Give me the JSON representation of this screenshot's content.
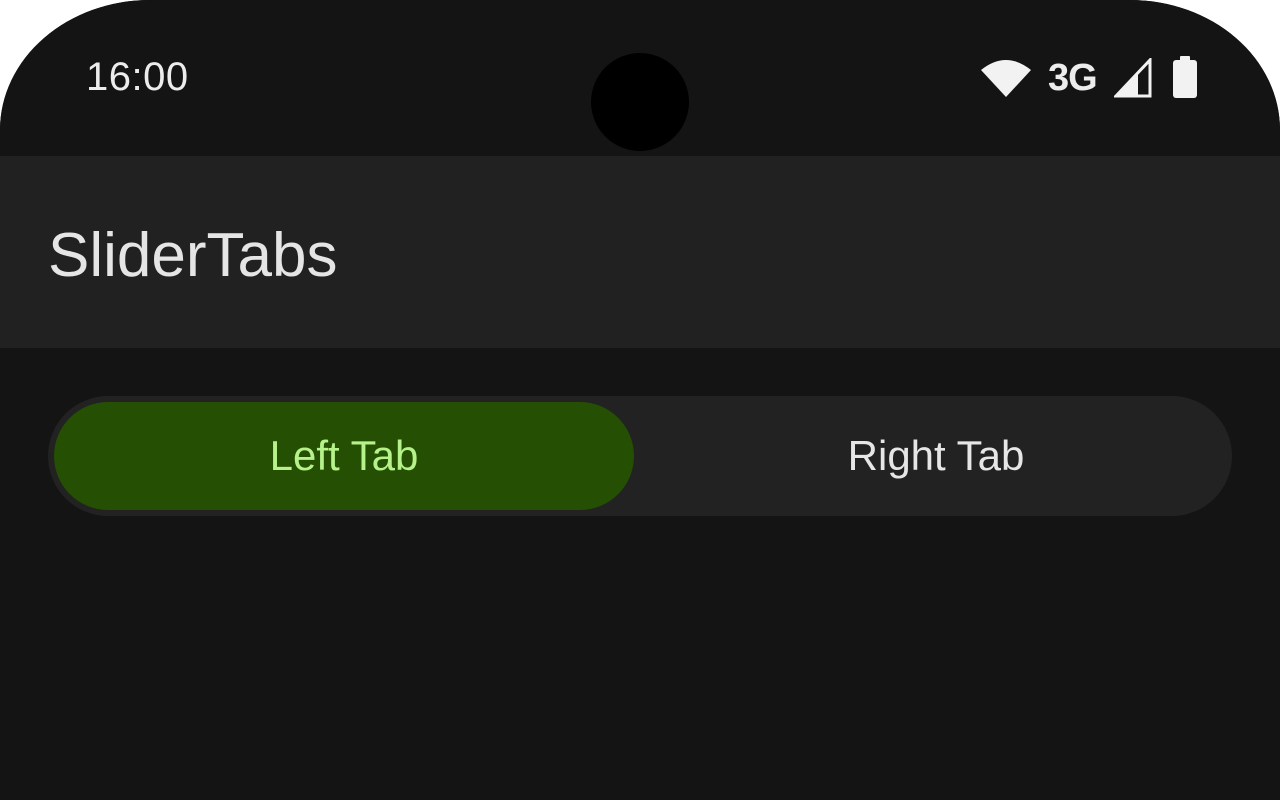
{
  "status_bar": {
    "time": "16:00",
    "network_type": "3G",
    "icons": [
      "wifi-icon",
      "cell-signal-icon",
      "battery-icon"
    ]
  },
  "app_bar": {
    "title": "SliderTabs"
  },
  "tabs": {
    "items": [
      {
        "label": "Left Tab",
        "selected": true
      },
      {
        "label": "Right Tab",
        "selected": false
      }
    ],
    "colors": {
      "selected_bg": "#254f02",
      "selected_text": "#b5f28a",
      "unselected_text": "#e6e6e6",
      "track_bg": "#222222"
    }
  },
  "theme": {
    "background": "#141414",
    "app_bar_bg": "#212121"
  }
}
